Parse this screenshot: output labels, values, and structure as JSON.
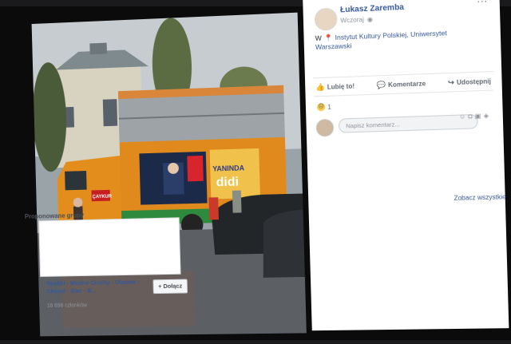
{
  "post": {
    "author": "Łukasz Zaremba",
    "time": "Wczoraj",
    "privacy_icon": "globe-icon",
    "location_prefix": "W",
    "location": "Instytut Kultury Polskiej, Uniwersytet Warszawski",
    "more_label": "..."
  },
  "actions": {
    "like": "Lubię to!",
    "comment": "Komentarze",
    "share": "Udostępnij"
  },
  "reactions": {
    "count": "1",
    "type_icon": "sad-reaction-icon"
  },
  "comment_box": {
    "placeholder": "Napisz komentarz..."
  },
  "suggestions": {
    "title": "Proponowane grupy",
    "see_all": "Zobacz wszystkie",
    "group_name": "Repliki - Modne Ciuchy - Obuwie - Chanel - Dior - B...",
    "group_members": "18 698 członków",
    "join_label": "+ Dołącz"
  },
  "photo": {
    "truck_brand": "ÇAYKUR",
    "banner_text_1": "YANINDA",
    "banner_text_2": "didi"
  },
  "colors": {
    "link": "#365899",
    "truck_orange": "#e08a1e",
    "truck_green": "#2e8b3e"
  }
}
